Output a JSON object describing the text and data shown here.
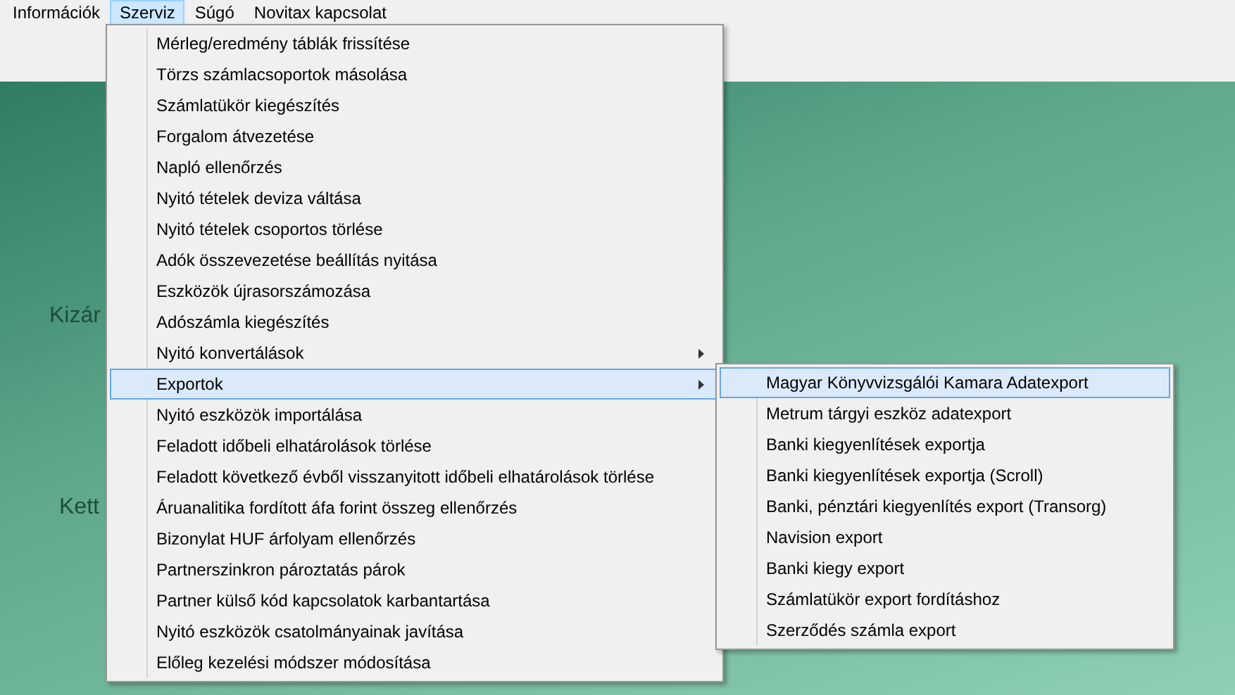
{
  "menu_bar": [
    {
      "label": "Információk",
      "selected": false
    },
    {
      "label": "Szerviz",
      "selected": true
    },
    {
      "label": "Súgó",
      "selected": false
    },
    {
      "label": "Novitax kapcsolat",
      "selected": false
    }
  ],
  "background_labels": [
    {
      "text": "Kizár"
    },
    {
      "text": "Kett"
    }
  ],
  "menu": [
    {
      "label": "Mérleg/eredmény táblák frissítése",
      "selected": false,
      "has_submenu": false
    },
    {
      "label": "Törzs számlacsoportok másolása",
      "selected": false,
      "has_submenu": false
    },
    {
      "label": "Számlatükör kiegészítés",
      "selected": false,
      "has_submenu": false
    },
    {
      "label": "Forgalom átvezetése",
      "selected": false,
      "has_submenu": false
    },
    {
      "label": "Napló ellenőrzés",
      "selected": false,
      "has_submenu": false
    },
    {
      "label": "Nyitó tételek deviza váltása",
      "selected": false,
      "has_submenu": false
    },
    {
      "label": "Nyitó tételek csoportos törlése",
      "selected": false,
      "has_submenu": false
    },
    {
      "label": "Adók összevezetése beállítás nyitása",
      "selected": false,
      "has_submenu": false
    },
    {
      "label": "Eszközök újrasorszámozása",
      "selected": false,
      "has_submenu": false
    },
    {
      "label": "Adószámla kiegészítés",
      "selected": false,
      "has_submenu": false
    },
    {
      "label": "Nyitó konvertálások",
      "selected": false,
      "has_submenu": true
    },
    {
      "label": "Exportok",
      "selected": true,
      "has_submenu": true
    },
    {
      "label": "Nyitó eszközök importálása",
      "selected": false,
      "has_submenu": false
    },
    {
      "label": "Feladott időbeli elhatárolások törlése",
      "selected": false,
      "has_submenu": false
    },
    {
      "label": "Feladott következő évből visszanyitott időbeli elhatárolások törlése",
      "selected": false,
      "has_submenu": false
    },
    {
      "label": "Áruanalitika fordított áfa forint összeg ellenőrzés",
      "selected": false,
      "has_submenu": false
    },
    {
      "label": "Bizonylat HUF árfolyam ellenőrzés",
      "selected": false,
      "has_submenu": false
    },
    {
      "label": "Partnerszinkron pároztatás párok",
      "selected": false,
      "has_submenu": false
    },
    {
      "label": "Partner külső kód kapcsolatok karbantartása",
      "selected": false,
      "has_submenu": false
    },
    {
      "label": "Nyitó eszközök csatolmányainak javítása",
      "selected": false,
      "has_submenu": false
    },
    {
      "label": "Előleg kezelési módszer módosítása",
      "selected": false,
      "has_submenu": false
    }
  ],
  "submenu": [
    {
      "label": "Magyar Könyvvizsgálói Kamara Adatexport",
      "selected": true
    },
    {
      "label": "Metrum tárgyi eszköz adatexport",
      "selected": false
    },
    {
      "label": "Banki kiegyenlítések exportja",
      "selected": false
    },
    {
      "label": "Banki kiegyenlítések exportja (Scroll)",
      "selected": false
    },
    {
      "label": "Banki, pénztári kiegyenlítés export (Transorg)",
      "selected": false
    },
    {
      "label": "Navision export",
      "selected": false
    },
    {
      "label": "Banki kiegy export",
      "selected": false
    },
    {
      "label": "Számlatükör export fordításhoz",
      "selected": false
    },
    {
      "label": "Szerződés számla export",
      "selected": false
    }
  ]
}
